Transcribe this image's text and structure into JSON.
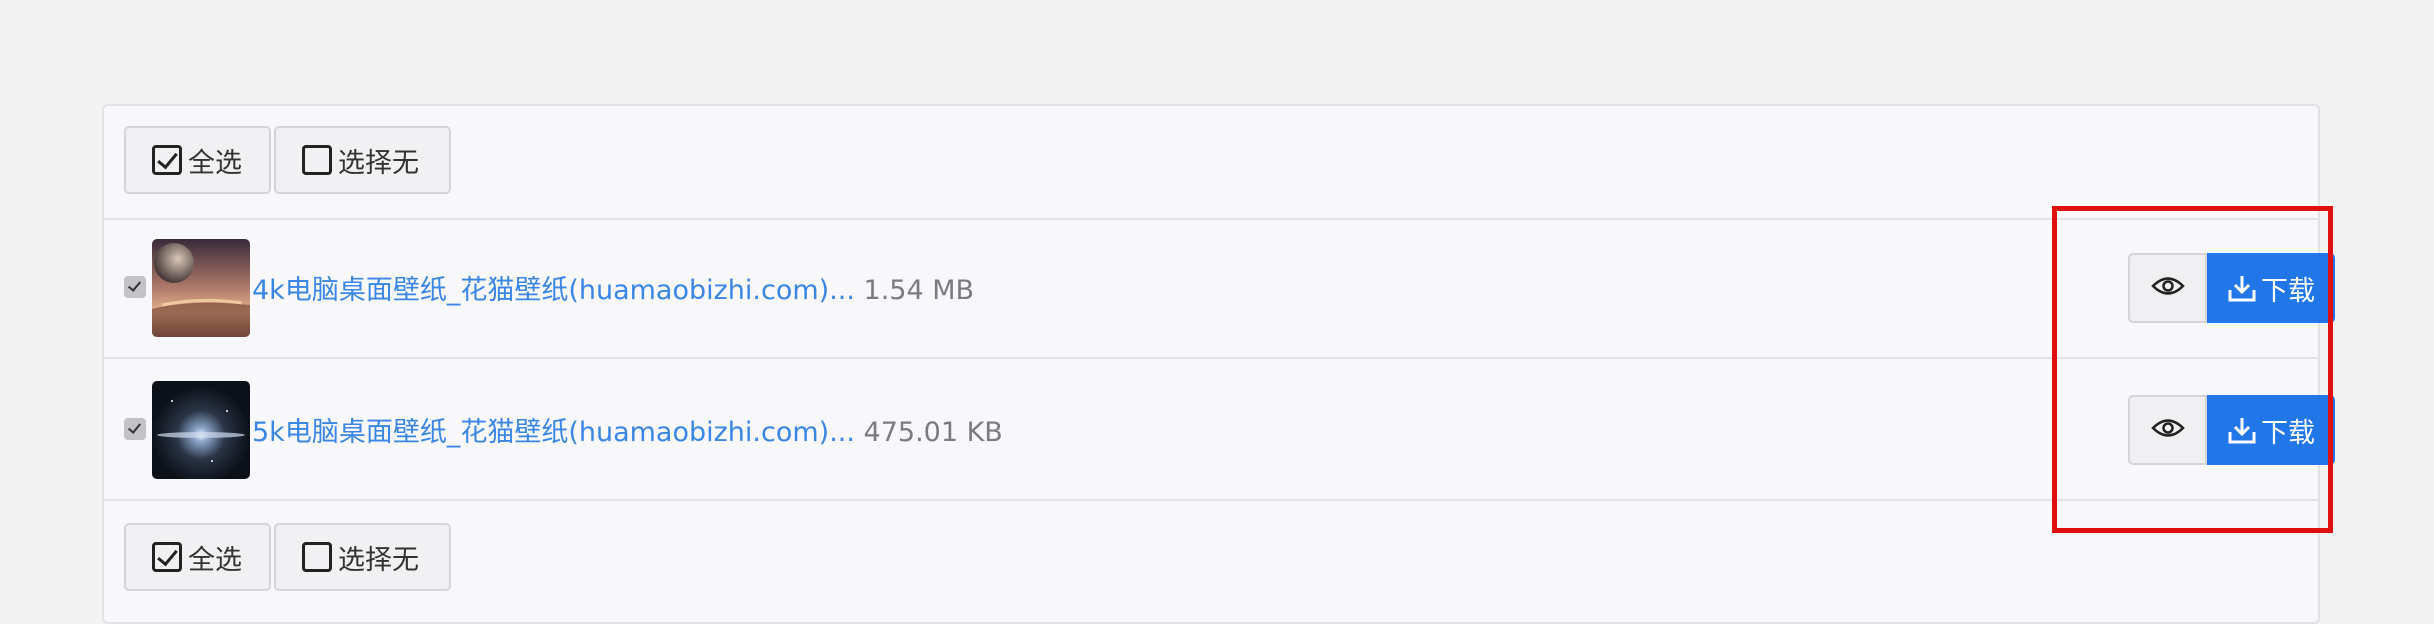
{
  "toolbar": {
    "select_all_label": "全选",
    "select_none_label": "选择无"
  },
  "files": [
    {
      "name": "4k电脑桌面壁纸_花猫壁纸(huamaobizhi.com)...",
      "size": "1.54 MB",
      "checked": true
    },
    {
      "name": "5k电脑桌面壁纸_花猫壁纸(huamaobizhi.com)...",
      "size": "475.01 KB",
      "checked": true
    }
  ],
  "actions": {
    "download_label": "下载",
    "view_icon": "eye-icon",
    "download_icon": "download-icon"
  },
  "colors": {
    "accent": "#2177e8",
    "link": "#3a86e6",
    "highlight": "#e01010"
  }
}
